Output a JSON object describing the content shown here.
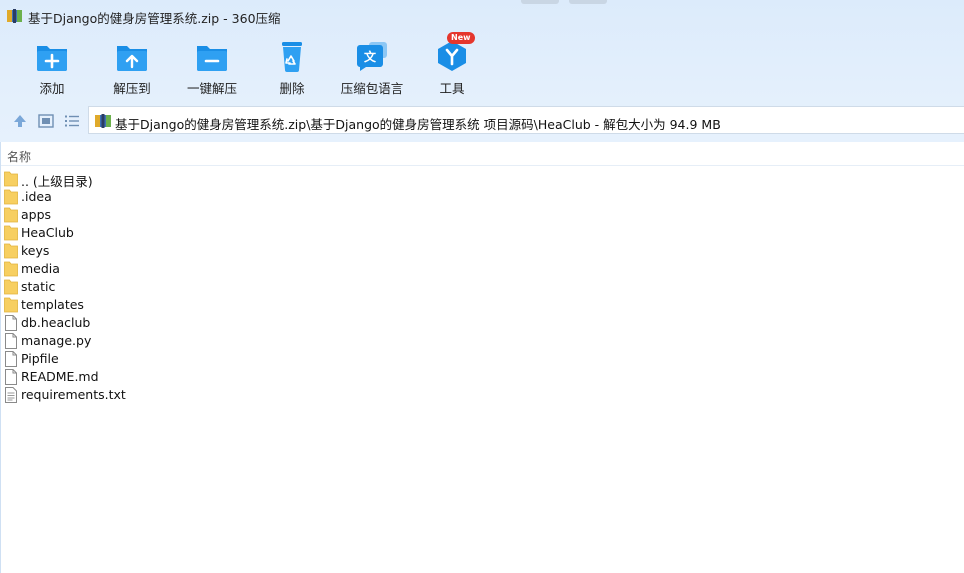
{
  "window": {
    "title": "基于Django的健身房管理系统.zip - 360压缩"
  },
  "toolbar": {
    "buttons": [
      {
        "id": "add",
        "label": "添加",
        "icon": "add-folder-icon"
      },
      {
        "id": "extract-to",
        "label": "解压到",
        "icon": "extract-to-icon"
      },
      {
        "id": "extract-one-click",
        "label": "一键解压",
        "icon": "one-click-extract-icon"
      },
      {
        "id": "delete",
        "label": "删除",
        "icon": "recycle-bin-icon"
      },
      {
        "id": "language",
        "label": "压缩包语言",
        "icon": "language-icon"
      },
      {
        "id": "tools",
        "label": "工具",
        "icon": "tools-icon",
        "badge": "New"
      }
    ]
  },
  "navigation": {
    "icons": [
      "up-arrow-icon",
      "thumbnail-view-icon",
      "list-view-icon"
    ],
    "address": "基于Django的健身房管理系统.zip\\基于Django的健身房管理系统 项目源码\\HeaClub - 解包大小为 94.9 MB"
  },
  "filelist": {
    "column_name": "名称",
    "items": [
      {
        "name": ".. (上级目录)",
        "type": "folder"
      },
      {
        "name": ".idea",
        "type": "folder"
      },
      {
        "name": "apps",
        "type": "folder"
      },
      {
        "name": "HeaClub",
        "type": "folder"
      },
      {
        "name": "keys",
        "type": "folder"
      },
      {
        "name": "media",
        "type": "folder"
      },
      {
        "name": "static",
        "type": "folder"
      },
      {
        "name": "templates",
        "type": "folder"
      },
      {
        "name": "db.heaclub",
        "type": "file"
      },
      {
        "name": "manage.py",
        "type": "file"
      },
      {
        "name": "Pipfile",
        "type": "file"
      },
      {
        "name": "README.md",
        "type": "file"
      },
      {
        "name": "requirements.txt",
        "type": "text"
      }
    ]
  },
  "colors": {
    "accent": "#1a8ee6",
    "folder": "#f7cf61",
    "badge": "#e5362d"
  }
}
